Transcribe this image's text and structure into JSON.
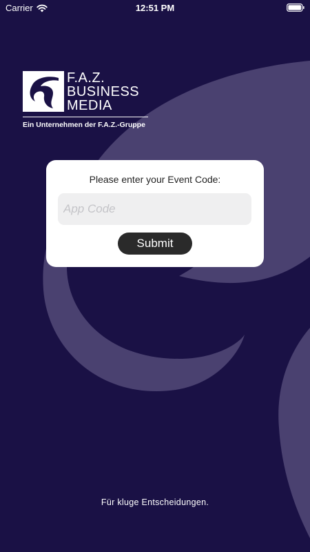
{
  "status_bar": {
    "carrier": "Carrier",
    "time": "12:51 PM",
    "wifi_icon": "wifi-icon",
    "battery_icon": "battery-icon"
  },
  "logo": {
    "line1": "F.A.Z.",
    "line2": "BUSINESS",
    "line3": "MEDIA",
    "tagline": "Ein Unternehmen der F.A.Z.-Gruppe"
  },
  "login_card": {
    "prompt": "Please enter your Event Code:",
    "input_value": "",
    "input_placeholder": "App Code",
    "submit_label": "Submit"
  },
  "footer": {
    "slogan": "Für kluge Entscheidungen."
  },
  "colors": {
    "background": "#1a1145",
    "swirl": "#4a4170",
    "card": "#ffffff",
    "button": "#2a2a2a"
  }
}
